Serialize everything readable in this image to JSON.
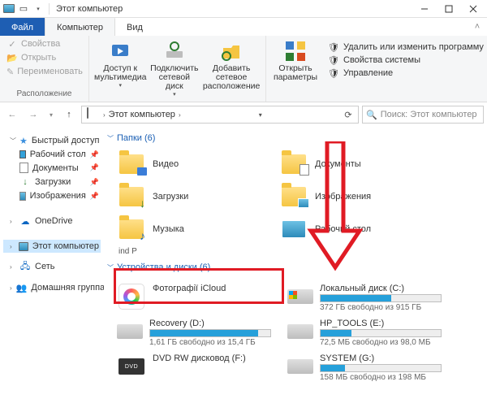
{
  "window": {
    "title": "Этот компьютер"
  },
  "tabs": {
    "file": "Файл",
    "computer": "Компьютер",
    "view": "Вид"
  },
  "ribbon": {
    "props": "Свойства",
    "open": "Открыть",
    "rename": "Переименовать",
    "group_location": "Расположение",
    "media": "Доступ к мультимедиа",
    "netdrive": "Подключить сетевой диск",
    "addnet": "Добавить сетевое расположение",
    "openparams": "Открыть параметры",
    "sys1": "Удалить или изменить программу",
    "sys2": "Свойства системы",
    "sys3": "Управление"
  },
  "breadcrumb": {
    "seg1": "Этот компьютер",
    "search_placeholder": "Поиск: Этот компьютер"
  },
  "sidebar": {
    "quick": "Быстрый доступ",
    "desktop": "Рабочий стол",
    "documents": "Документы",
    "downloads": "Загрузки",
    "pictures": "Изображения",
    "onedrive": "OneDrive",
    "thispc": "Этот компьютер",
    "network": "Сеть",
    "homegroup": "Домашняя группа"
  },
  "sections": {
    "folders_hdr": "Папки (6)",
    "drives_hdr": "Устройства и диски (6)",
    "trunc": "ind P"
  },
  "folders": {
    "video": "Видео",
    "documents": "Документы",
    "downloads": "Загрузки",
    "pictures": "Изображения",
    "music": "Музыка",
    "desktop": "Рабочий стол"
  },
  "drives": [
    {
      "name": "Фотографії iCloud",
      "sub": "",
      "fill": 0,
      "bar": false,
      "icon": "photos"
    },
    {
      "name": "Локальный диск (C:)",
      "sub": "372 ГБ свободно из 915 ГБ",
      "fill": 59,
      "bar": true,
      "icon": "hddwin"
    },
    {
      "name": "Recovery (D:)",
      "sub": "1,61 ГБ свободно из 15,4 ГБ",
      "fill": 90,
      "bar": true,
      "icon": "hdd"
    },
    {
      "name": "HP_TOOLS (E:)",
      "sub": "72,5 МБ свободно из 98,0 МБ",
      "fill": 26,
      "bar": true,
      "icon": "hdd"
    },
    {
      "name": "DVD RW дисковод (F:)",
      "sub": "",
      "fill": 0,
      "bar": false,
      "icon": "dvd"
    },
    {
      "name": "SYSTEM (G:)",
      "sub": "158 МБ свободно из 198 МБ",
      "fill": 20,
      "bar": true,
      "icon": "hdd"
    }
  ]
}
